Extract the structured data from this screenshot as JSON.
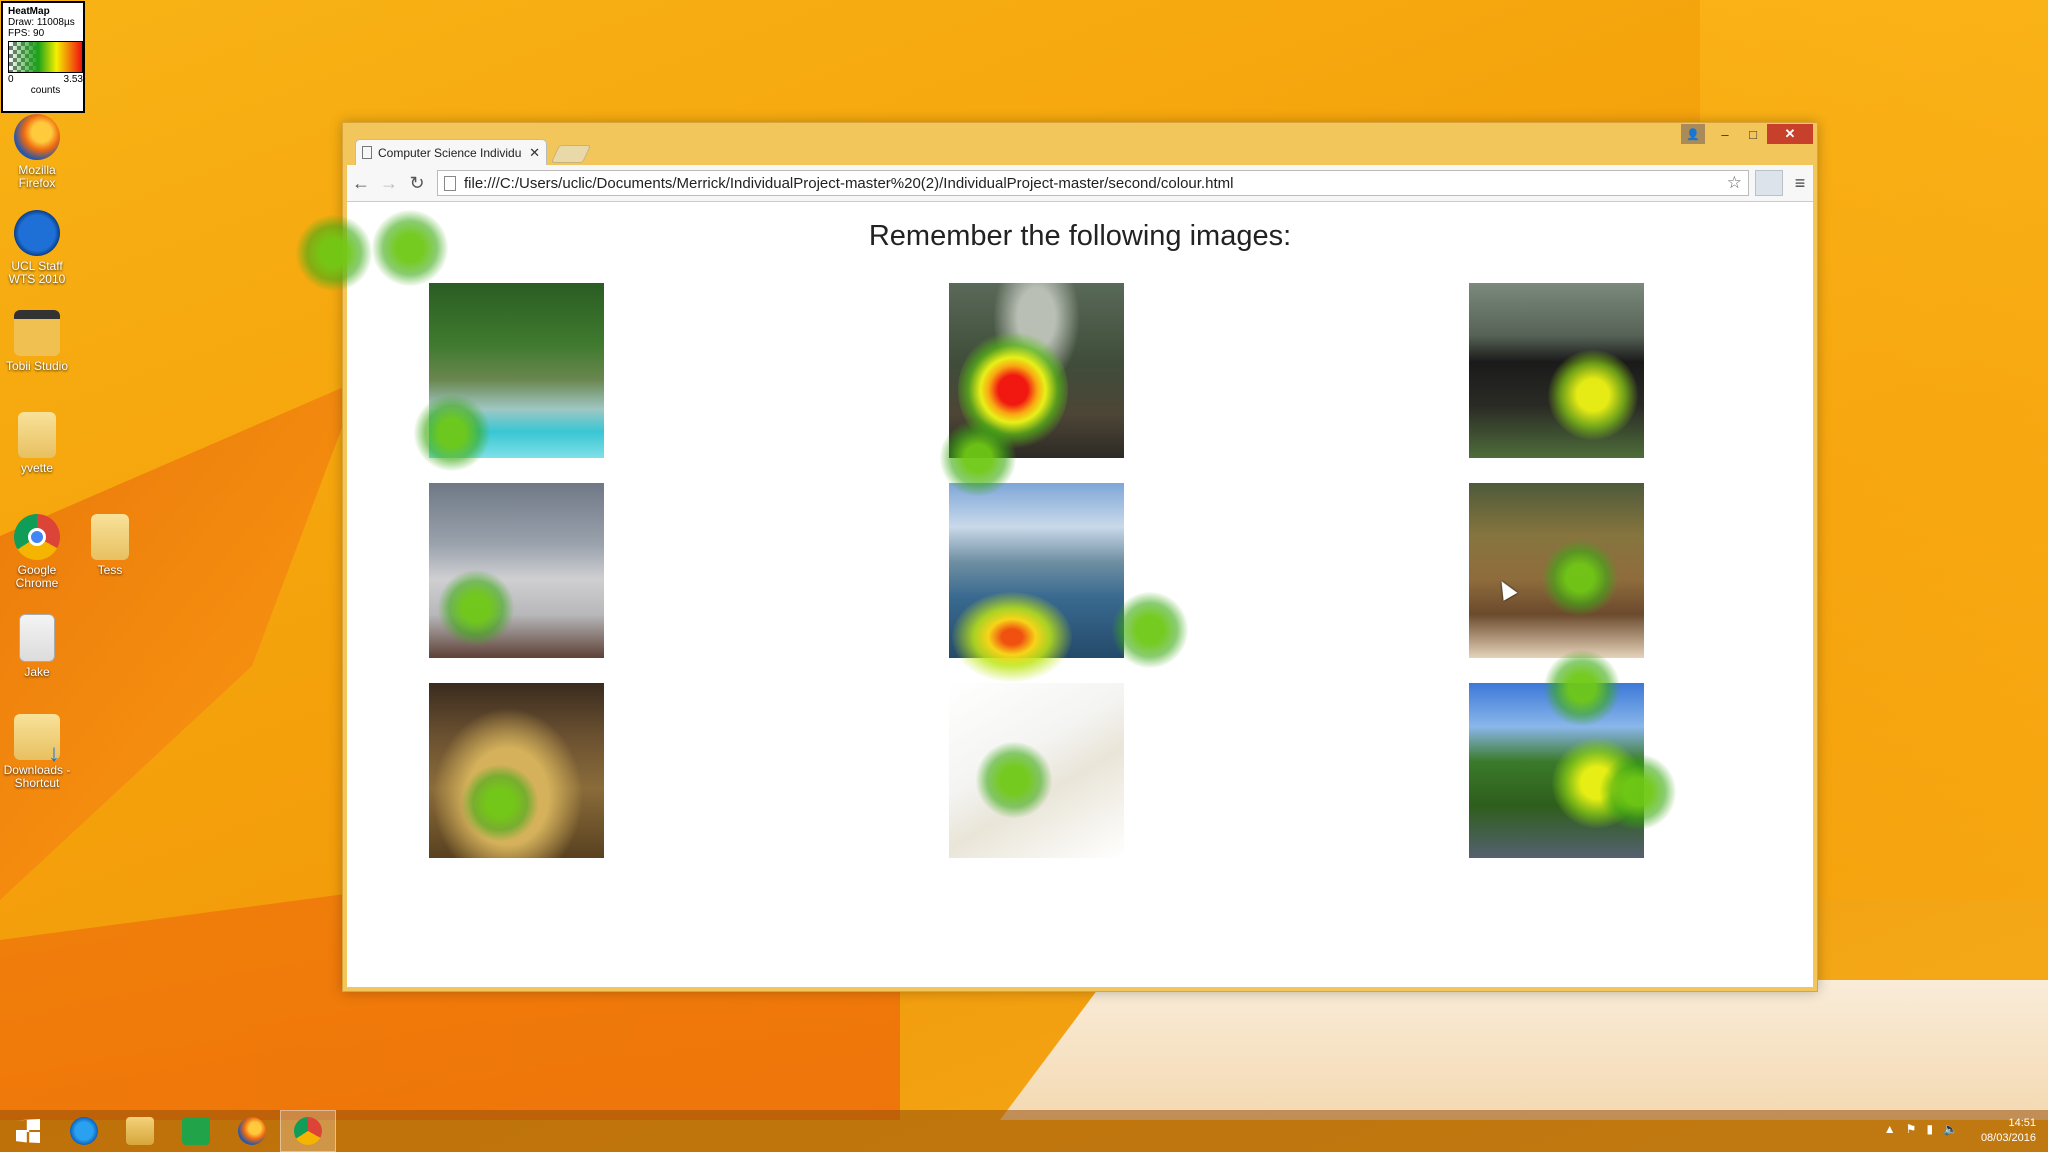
{
  "heatmap_legend": {
    "title": "HeatMap",
    "draw": "Draw: 11008µs",
    "fps": "FPS: 90",
    "min": "0",
    "max": "3.53",
    "unit": "counts"
  },
  "desktop_icons": [
    {
      "label": "Mozilla Firefox",
      "icon": "firefox-icon"
    },
    {
      "label": "UCL Staff WTS 2010",
      "icon": "remote-desktop-icon"
    },
    {
      "label": "Tobii Studio",
      "icon": "tobii-studio-icon"
    },
    {
      "label": "yvette",
      "icon": "folder-icon"
    },
    {
      "label": "Google Chrome",
      "icon": "chrome-icon"
    },
    {
      "label": "Tess",
      "icon": "folder-icon"
    },
    {
      "label": "Jake",
      "icon": "document-icon"
    },
    {
      "label": "Downloads - Shortcut",
      "icon": "downloads-folder-icon"
    }
  ],
  "browser": {
    "tab_title": "Computer Science Individu",
    "url": "file:///C:/Users/uclic/Documents/Merrick/IndividualProject-master%20(2)/IndividualProject-master/second/colour.html",
    "window_controls": {
      "minimize": "–",
      "maximize": "□",
      "close": "✕",
      "user": "👤"
    }
  },
  "page": {
    "title": "Remember the following images:",
    "images": [
      {
        "subject": "jungle-beach"
      },
      {
        "subject": "forest-path"
      },
      {
        "subject": "rugby-players"
      },
      {
        "subject": "dishwasher"
      },
      {
        "subject": "lake-mountain-view"
      },
      {
        "subject": "aquarium"
      },
      {
        "subject": "perfume-bottle"
      },
      {
        "subject": "fountain-pen"
      },
      {
        "subject": "park-staircase"
      }
    ]
  },
  "taskbar": {
    "apps": [
      "start",
      "internet-explorer",
      "file-explorer",
      "store",
      "firefox",
      "chrome"
    ],
    "active_app": "chrome",
    "time": "14:51",
    "date": "08/03/2016"
  },
  "colors": {
    "heat_low": "#3caa14",
    "heat_mid": "#f0f014",
    "heat_high": "#f01810",
    "close_button": "#c7402c"
  }
}
